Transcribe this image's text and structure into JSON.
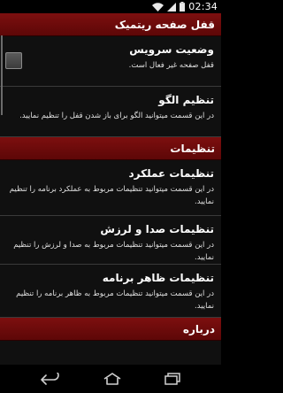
{
  "status_bar": {
    "time": "02:34",
    "icons": [
      "wifi-icon",
      "signal-icon",
      "battery-icon"
    ]
  },
  "sections": {
    "lock": {
      "header": "قفل صفحه ریتمیک",
      "service": {
        "title": "وضعیت سرویس",
        "summary": "قفل صفحه غیر فعال است.",
        "checked": false
      },
      "pattern": {
        "title": "تنظیم الگو",
        "summary": "در این قسمت میتوانید الگو برای باز شدن قفل را تنظیم نمایید."
      }
    },
    "settings": {
      "header": "تنظیمات",
      "performance": {
        "title": "تنظیمات عملکرد",
        "summary": "در این قسمت میتوانید تنظیمات مربوط به عملکرد برنامه را تنظیم نمایید."
      },
      "sound": {
        "title": "تنظیمات صدا و لرزش",
        "summary": "در این قسمت میتوانید تنظیمات مربوط به صدا و لرزش را تنظیم نمایید."
      },
      "appearance": {
        "title": "تنظیمات ظاهر برنامه",
        "summary": "در این قسمت میتوانید تنظیمات مربوط به ظاهر برنامه را تنظیم نمایید."
      }
    },
    "about": {
      "header": "درباره"
    }
  },
  "nav_bar": {
    "icons": [
      "back-icon",
      "home-icon",
      "recent-apps-icon"
    ]
  },
  "colors": {
    "header_bg": "#6b0a0a",
    "background": "#101010",
    "divider": "#3a3a3a"
  }
}
